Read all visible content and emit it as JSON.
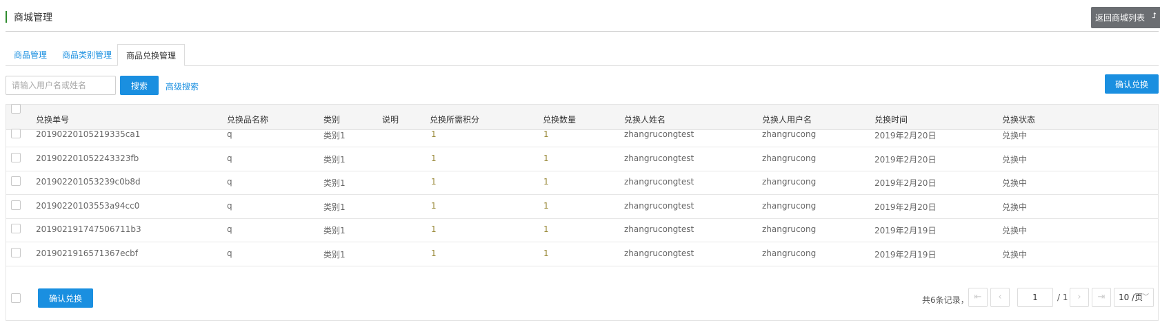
{
  "header": {
    "title": "商城管理",
    "back_label": "返回商城列表"
  },
  "tabs": [
    {
      "label": "商品管理"
    },
    {
      "label": "商品类别管理"
    },
    {
      "label": "商品兑换管理"
    }
  ],
  "search": {
    "placeholder": "请输入用户名或姓名",
    "value": "",
    "button": "搜索",
    "advanced": "高级搜索"
  },
  "actions": {
    "confirm_top": "确认兑换",
    "confirm_bottom": "确认兑换"
  },
  "table": {
    "headers": [
      "兑换单号",
      "兑换品名称",
      "类别",
      "说明",
      "兑换所需积分",
      "兑换数量",
      "兑换人姓名",
      "兑换人用户名",
      "兑换时间",
      "兑换状态"
    ],
    "rows": [
      [
        "20190220105219335ca1",
        "q",
        "类别1",
        "",
        "1",
        "1",
        "zhangrucongtest",
        "zhangrucong",
        "2019年2月20日",
        "兑换中"
      ],
      [
        "201902201052243323fb",
        "q",
        "类别1",
        "",
        "1",
        "1",
        "zhangrucongtest",
        "zhangrucong",
        "2019年2月20日",
        "兑换中"
      ],
      [
        "201902201053239c0b8d",
        "q",
        "类别1",
        "",
        "1",
        "1",
        "zhangrucongtest",
        "zhangrucong",
        "2019年2月20日",
        "兑换中"
      ],
      [
        "20190220103553a94cc0",
        "q",
        "类别1",
        "",
        "1",
        "1",
        "zhangrucongtest",
        "zhangrucong",
        "2019年2月20日",
        "兑换中"
      ],
      [
        "201902191747506711b3",
        "q",
        "类别1",
        "",
        "1",
        "1",
        "zhangrucongtest",
        "zhangrucong",
        "2019年2月19日",
        "兑换中"
      ],
      [
        "2019021916571367ecbf",
        "q",
        "类别1",
        "",
        "1",
        "1",
        "zhangrucongtest",
        "zhangrucong",
        "2019年2月19日",
        "兑换中"
      ]
    ]
  },
  "pagination": {
    "total_text": "共6条记录，",
    "current_page": "1",
    "total_pages_text": "/ 1",
    "page_size": "10 /页",
    "icons": [
      "first-page-icon",
      "prev-page-icon",
      "next-page-icon",
      "last-page-icon"
    ]
  },
  "colors": {
    "primary": "#1a8fe0",
    "back_button": "#6b6e72",
    "title_bar": "#2e8b2e",
    "numeric_text": "#9a8a3a"
  }
}
